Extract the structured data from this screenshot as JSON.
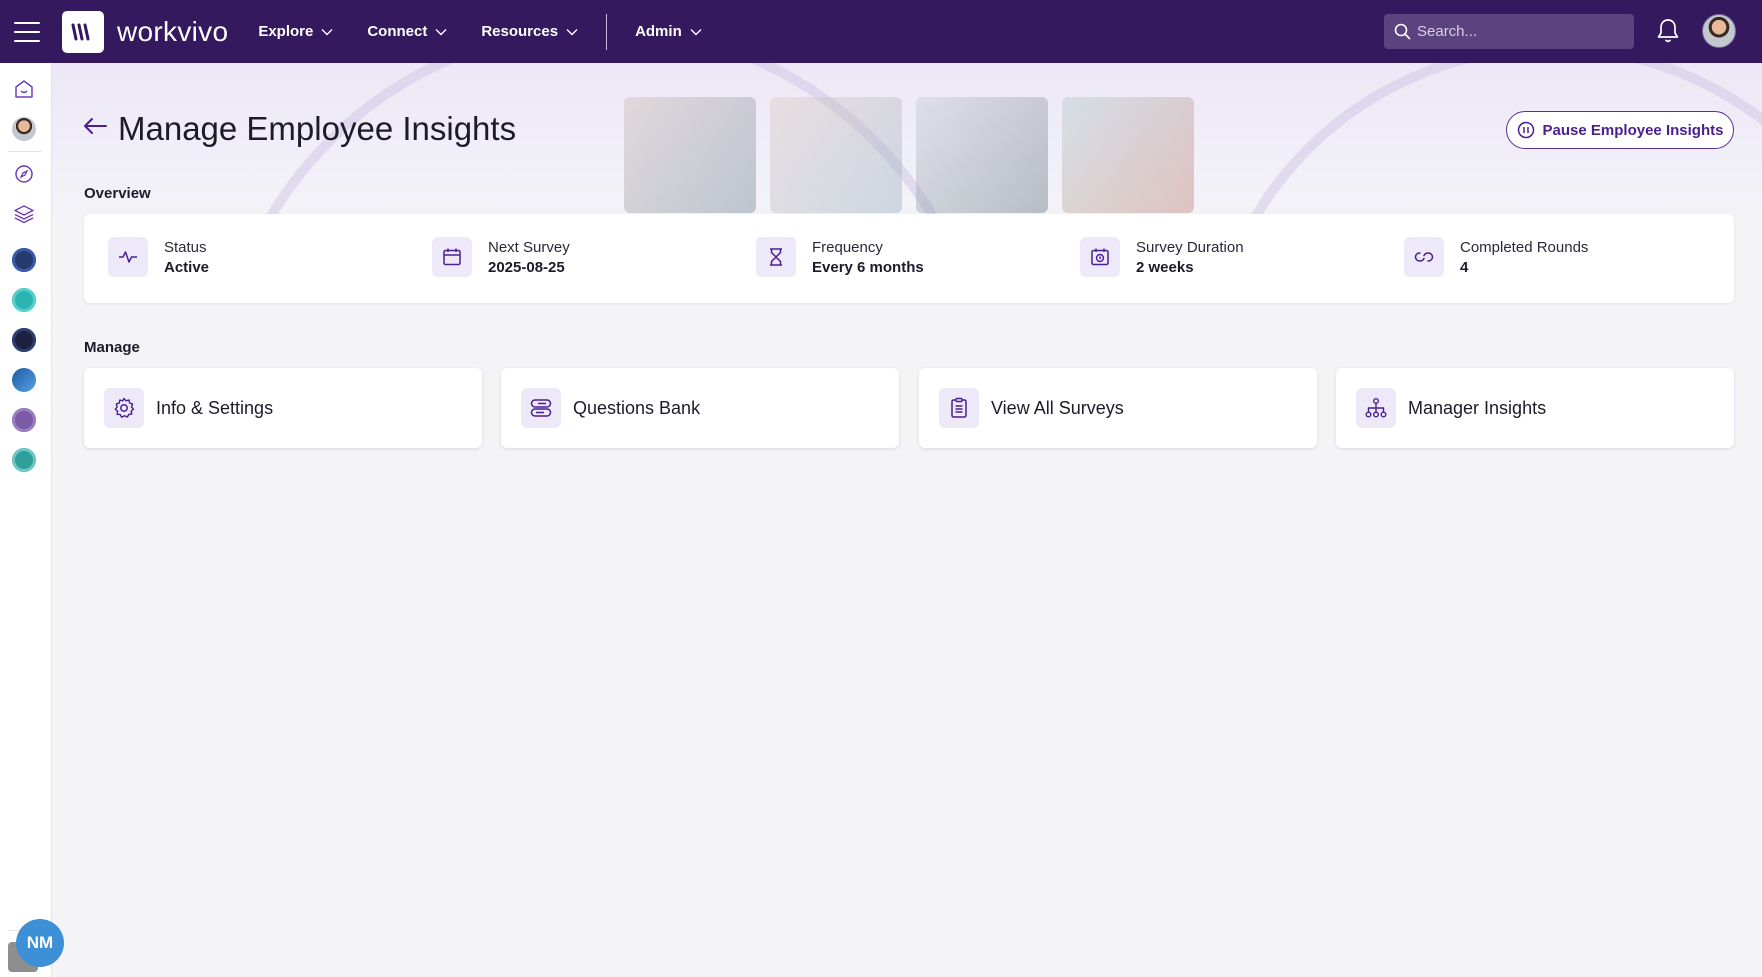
{
  "topbar": {
    "logo_text": "workvivo",
    "nav": [
      "Explore",
      "Connect",
      "Resources"
    ],
    "admin_label": "Admin",
    "search_placeholder": "Search..."
  },
  "page": {
    "title": "Manage Employee Insights",
    "pause_label": "Pause Employee Insights"
  },
  "overview": {
    "heading": "Overview",
    "items": [
      {
        "label": "Status",
        "value": "Active",
        "icon": "activity-icon"
      },
      {
        "label": "Next Survey",
        "value": "2025-08-25",
        "icon": "calendar-icon"
      },
      {
        "label": "Frequency",
        "value": "Every 6 months",
        "icon": "hourglass-icon"
      },
      {
        "label": "Survey Duration",
        "value": "2 weeks",
        "icon": "timer-icon"
      },
      {
        "label": "Completed Rounds",
        "value": "4",
        "icon": "loop-icon"
      }
    ]
  },
  "manage": {
    "heading": "Manage",
    "cards": [
      {
        "label": "Info & Settings",
        "icon": "gear-icon"
      },
      {
        "label": "Questions Bank",
        "icon": "database-icon"
      },
      {
        "label": "View All Surveys",
        "icon": "clipboard-icon"
      },
      {
        "label": "Manager Insights",
        "icon": "org-chart-icon"
      }
    ]
  },
  "sidebar": {
    "user_initials": "NM"
  },
  "colors": {
    "topbar": "#35195e",
    "accent": "#4a1f8f",
    "icon_bg": "#eee9f8",
    "page_bg": "#f4f4f7"
  }
}
